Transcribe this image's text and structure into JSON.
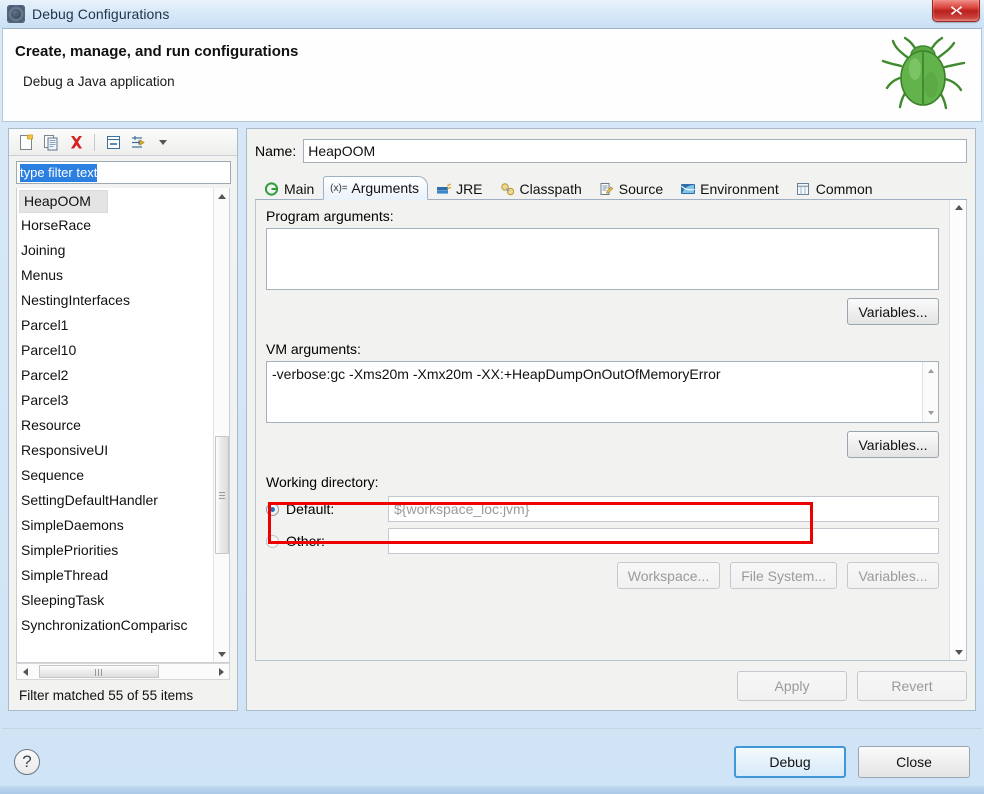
{
  "window": {
    "title": "Debug Configurations",
    "title_icon": "debug-config-icon",
    "close_label": "✕"
  },
  "header": {
    "title": "Create, manage, and run configurations",
    "subtitle": "Debug a Java application",
    "icon": "green-bug-icon"
  },
  "left_panel": {
    "toolbar": [
      {
        "name": "new-configuration-icon",
        "tooltip": "New launch configuration"
      },
      {
        "name": "duplicate-configuration-icon",
        "tooltip": "Duplicate"
      },
      {
        "name": "delete-configuration-icon",
        "tooltip": "Delete"
      },
      {
        "name": "collapse-all-icon",
        "tooltip": "Collapse All"
      },
      {
        "name": "filter-launch-configurations-icon",
        "tooltip": "Filter"
      },
      {
        "name": "chevron-down-icon",
        "tooltip": "View Menu"
      }
    ],
    "filter": {
      "value": "type filter text",
      "placeholder": "type filter text",
      "selected": true
    },
    "items": [
      "HeapOOM",
      "HorseRace",
      "Joining",
      "Menus",
      "NestingInterfaces",
      "Parcel1",
      "Parcel10",
      "Parcel2",
      "Parcel3",
      "Resource",
      "ResponsiveUI",
      "Sequence",
      "SettingDefaultHandler",
      "SimpleDaemons",
      "SimplePriorities",
      "SimpleThread",
      "SleepingTask",
      "SynchronizationComparisc"
    ],
    "selected_item": "HeapOOM",
    "status": "Filter matched 55 of 55 items"
  },
  "right_panel": {
    "name_label": "Name:",
    "name_value": "HeapOOM",
    "tabs": [
      {
        "label": "Main",
        "icon": "main-tab-icon",
        "active": false
      },
      {
        "label": "Arguments",
        "icon": "arguments-tab-icon",
        "active": true
      },
      {
        "label": "JRE",
        "icon": "jre-tab-icon",
        "active": false
      },
      {
        "label": "Classpath",
        "icon": "classpath-tab-icon",
        "active": false
      },
      {
        "label": "Source",
        "icon": "source-tab-icon",
        "active": false
      },
      {
        "label": "Environment",
        "icon": "environment-tab-icon",
        "active": false
      },
      {
        "label": "Common",
        "icon": "common-tab-icon",
        "active": false
      }
    ],
    "program_arguments": {
      "label": "Program arguments:",
      "value": "",
      "variables_button": "Variables..."
    },
    "vm_arguments": {
      "label": "VM arguments:",
      "value": "-verbose:gc -Xms20m -Xmx20m -XX:+HeapDumpOnOutOfMemoryError",
      "variables_button": "Variables...",
      "highlight_color": "#ef0000"
    },
    "working_directory": {
      "label": "Working directory:",
      "default_label": "Default:",
      "default_value": "${workspace_loc:jvm}",
      "default_selected": true,
      "other_label": "Other:",
      "other_value": "",
      "other_selected": false,
      "workspace_button": "Workspace...",
      "file_system_button": "File System...",
      "variables_button": "Variables..."
    },
    "apply_button": "Apply",
    "revert_button": "Revert"
  },
  "footer": {
    "help_icon": "help-icon",
    "help_label": "?",
    "debug_button": "Debug",
    "close_button": "Close"
  },
  "colors": {
    "accent": "#3f97d8",
    "annotation": "#ef0000",
    "selection": "#2a7fe0",
    "titlebar_close": "#b8201c"
  }
}
